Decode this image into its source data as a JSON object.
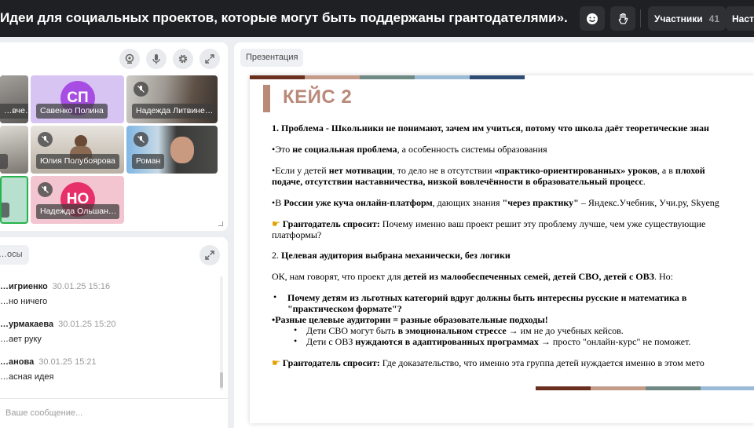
{
  "topbar": {
    "title": "Идеи для социальных проектов, которые могут быть поддержаны грантодателями». Провод…",
    "participants_label": "Участники",
    "participants_count": "41",
    "settings_label": "Наст"
  },
  "video": {
    "tiles": [
      {
        "name": "…вче…"
      },
      {
        "name": "Савенко Полина",
        "initials": "СП"
      },
      {
        "name": "Надежда Литвине…"
      },
      {
        "name": ""
      },
      {
        "name": "Юлия Полубоярова"
      },
      {
        "name": "Роман"
      },
      {
        "name": ""
      },
      {
        "name": "Надежда Ольшан…",
        "initials": "НО"
      }
    ]
  },
  "chat": {
    "tab_label": "…осы",
    "messages": [
      {
        "author": "…игриенко",
        "time": "30.01.25 15:16",
        "text": "…но ничего"
      },
      {
        "author": "…урмакаева",
        "time": "30.01.25 15:20",
        "text": "…ает руку"
      },
      {
        "author": "…анова",
        "time": "30.01.25 15:21",
        "text": "…асная идея"
      }
    ],
    "input_placeholder": "Ваше сообщение..."
  },
  "presentation": {
    "tab_label": "Презентация",
    "slide": {
      "title": "КЕЙС 2",
      "p1": "1. Проблема - Школьники не понимают, зачем им учиться, потому что школа даёт теоретические знан",
      "p2a": "•Это ",
      "p2b": "не социальная проблема",
      "p2c": ", а особенность системы образования",
      "p3a": "•Если у детей ",
      "p3b": "нет мотивации",
      "p3c": ", то дело не в отсутствии ",
      "p3d": "«практико-ориентированных» уроков",
      "p3e": ", а в ",
      "p3f": "плохой",
      "p3g": "подаче, отсутствии наставничества, низкой вовлечённости в образовательный процесс",
      "p3h": ".",
      "p4a": "•В ",
      "p4b": "России уже куча онлайн-платформ",
      "p4c": ", дающих знания ",
      "p4d": "\"через практику\"",
      "p4e": " – Яндекс.Учебник, Учи.ру, Skyeng",
      "p5a": "Грантодатель спросит:",
      "p5b": " Почему именно ваш проект решит эту проблему лучше, чем уже существующие",
      "p5c": "платформы?",
      "p6a": "2. ",
      "p6b": "Целевая аудитория выбрана механически, без логики",
      "p7a": "ОК, нам говорят, что проект для ",
      "p7b": "детей из малообеспеченных семей, детей СВО, детей с ОВЗ",
      "p7c": ". Но:",
      "p8": "Почему детям из льготных категорий вдруг должны быть интересны русские и математика в",
      "p8b": "\"практическом формате\"?",
      "p9": "•Разные целевые аудитории = разные образовательные подходы!",
      "p10a": "Дети СВО могут быть ",
      "p10b": "в эмоциональном стрессе",
      "p10c": " → им не до учебных кейсов.",
      "p11a": "Дети с ОВЗ ",
      "p11b": "нуждаются в адаптированных программах",
      "p11c": " → просто \"онлайн-курс\" не поможет.",
      "p12a": "Грантодатель спросит:",
      "p12b": " Где доказательство, что именно эта группа детей нуждается именно в этом мето"
    }
  },
  "colors": {
    "stripe1": "#6b2f1f",
    "stripe2": "#c49a89",
    "stripe3": "#6f8a84",
    "stripe4": "#9bbad6",
    "stripe5": "#2d4b73",
    "accent": "#b98979"
  }
}
